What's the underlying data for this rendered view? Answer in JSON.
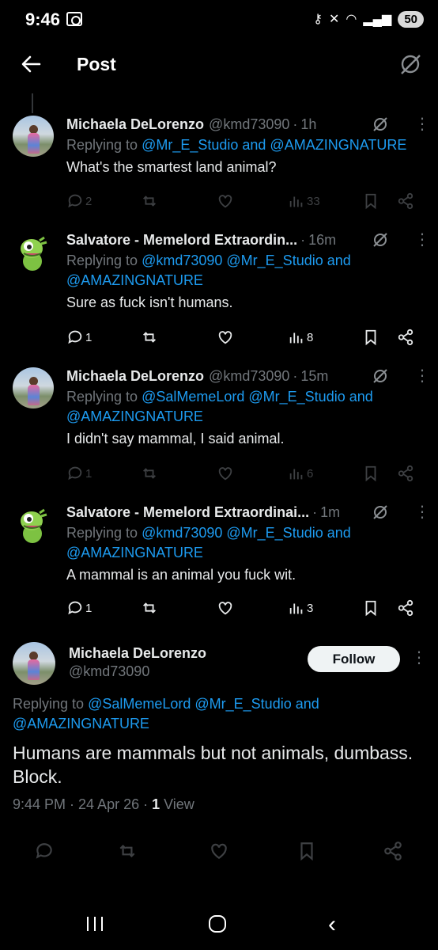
{
  "status": {
    "time": "9:46",
    "battery": "50",
    "network": "6E"
  },
  "header": {
    "title": "Post"
  },
  "replies": [
    {
      "name": "Michaela DeLorenzo",
      "handle": "@kmd73090",
      "time": "1h",
      "replying_prefix": "Replying to ",
      "replying_to": "@Mr_E_Studio and @AMAZINGNATURE",
      "text": "What's the smartest land animal?",
      "replies": "2",
      "reposts": "",
      "likes": "",
      "views": "33"
    },
    {
      "name": "Salvatore - Memelord Extraordin...",
      "handle": "",
      "time": "16m",
      "replying_prefix": "Replying to ",
      "replying_to": "@kmd73090 @Mr_E_Studio and @AMAZINGNATURE",
      "text": "Sure as fuck isn't humans.",
      "replies": "1",
      "reposts": "",
      "likes": "",
      "views": "8"
    },
    {
      "name": "Michaela DeLorenzo",
      "handle": "@kmd73090",
      "time": "15m",
      "replying_prefix": "Replying to ",
      "replying_to": "@SalMemeLord @Mr_E_Studio and @AMAZINGNATURE",
      "text": "I didn't say mammal, I said animal.",
      "replies": "1",
      "reposts": "",
      "likes": "",
      "views": "6"
    },
    {
      "name": "Salvatore - Memelord Extraordinai...",
      "handle": "",
      "time": "1m",
      "replying_prefix": "Replying to ",
      "replying_to": "@kmd73090 @Mr_E_Studio and @AMAZINGNATURE",
      "text": "A mammal is an animal you fuck wit.",
      "replies": "1",
      "reposts": "",
      "likes": "",
      "views": "3"
    }
  ],
  "main": {
    "name": "Michaela DeLorenzo",
    "handle": "@kmd73090",
    "follow_label": "Follow",
    "replying_prefix": "Replying to ",
    "replying_to": "@SalMemeLord @Mr_E_Studio and @AMAZINGNATURE",
    "text": "Humans are mammals but not animals, dumbass. Block.",
    "timestamp": "9:44 PM · 24 Apr 26 · ",
    "view_count": "1",
    "view_label": " View"
  },
  "colors": {
    "link": "#1d9bf0",
    "muted": "#71767b",
    "text": "#e7e9ea",
    "background": "#000000"
  }
}
